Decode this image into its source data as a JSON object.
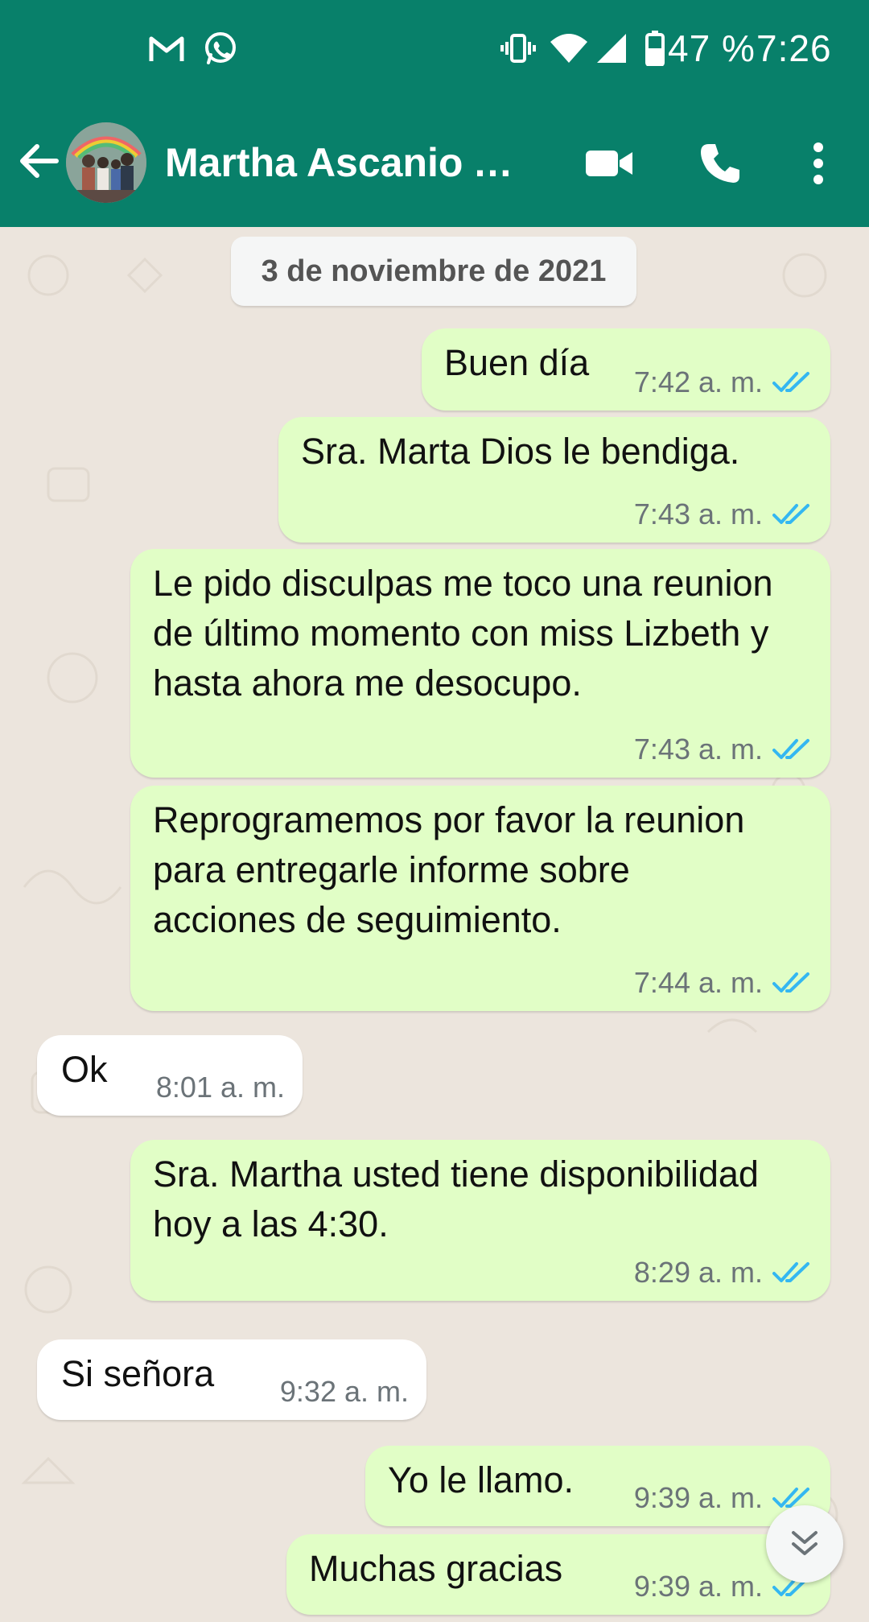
{
  "status_bar": {
    "battery": "47 %",
    "time": "7:26",
    "icons": [
      "gmail-icon",
      "whatsapp-icon",
      "vibrate-icon",
      "wifi-icon",
      "signal-icon",
      "battery-icon"
    ]
  },
  "header": {
    "contact_name": "Martha Ascanio Ascanio",
    "icons": [
      "back-arrow-icon",
      "avatar",
      "video-call-icon",
      "phone-call-icon",
      "more-options-icon"
    ],
    "color": "#08806a"
  },
  "chat": {
    "date_label": "3 de noviembre de 2021",
    "messages": [
      {
        "direction": "out",
        "text": "Buen día",
        "time": "7:42 a. m.",
        "status": "read"
      },
      {
        "direction": "out",
        "text": "Sra. Marta Dios le bendiga.",
        "time": "7:43 a. m.",
        "status": "read"
      },
      {
        "direction": "out",
        "text": "Le pido disculpas me toco una reunion de último momento con miss Lizbeth y hasta ahora me desocupo.",
        "time": "7:43 a. m.",
        "status": "read"
      },
      {
        "direction": "out",
        "text": "Reprogramemos por favor la reunion para entregarle informe sobre acciones de seguimiento.",
        "time": "7:44 a. m.",
        "status": "read"
      },
      {
        "direction": "in",
        "text": "Ok",
        "time": "8:01 a. m."
      },
      {
        "direction": "out",
        "text": "Sra. Martha usted tiene disponibilidad hoy a las 4:30.",
        "time": "8:29 a. m.",
        "status": "read"
      },
      {
        "direction": "in",
        "text": "Si señora",
        "time": "9:32 a. m."
      },
      {
        "direction": "out",
        "text": "Yo le llamo.",
        "time": "9:39 a. m.",
        "status": "read"
      },
      {
        "direction": "out",
        "text": "Muchas gracias",
        "time": "9:39 a. m.",
        "status": "read"
      }
    ]
  },
  "colors": {
    "outgoing_bubble": "#e1fec6",
    "incoming_bubble": "#ffffff",
    "read_ticks": "#34b7f1",
    "chat_background": "#ece5dd"
  }
}
